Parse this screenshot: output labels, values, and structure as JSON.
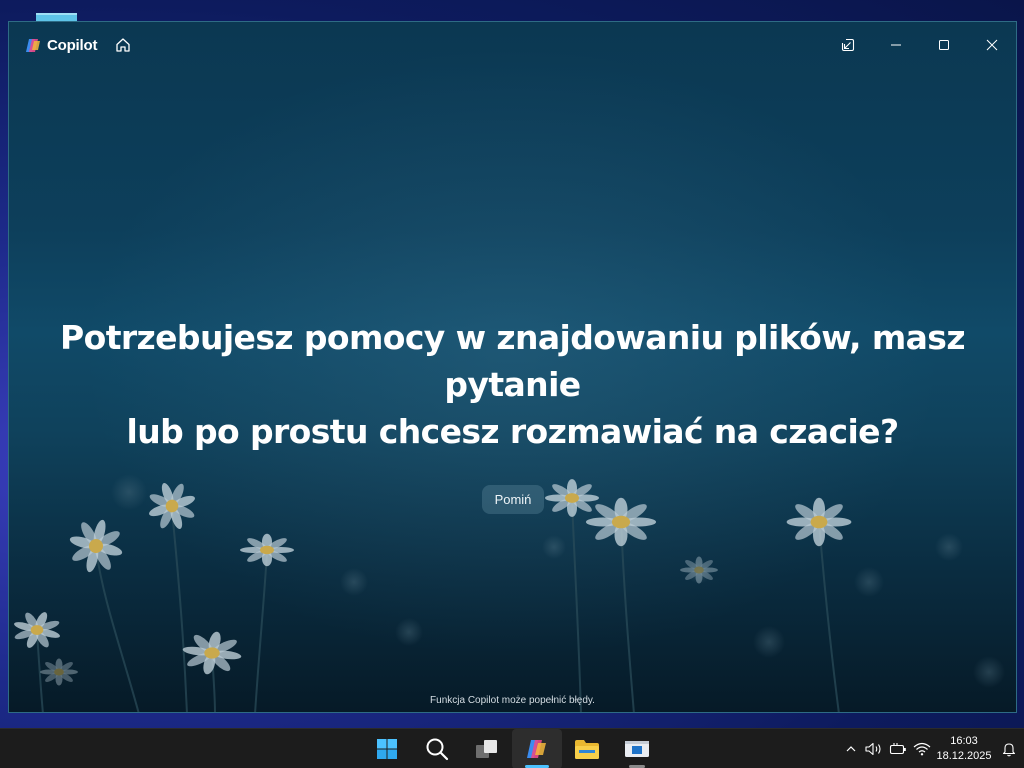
{
  "app": {
    "name": "Copilot"
  },
  "window": {
    "headline_line1": "Potrzebujesz pomocy w znajdowaniu plików, masz pytanie",
    "headline_line2": "lub po prostu chcesz rozmawiać na czacie?",
    "skip_label": "Pomiń",
    "disclaimer": "Funkcja Copilot może popełnić błędy."
  },
  "taskbar": {
    "time": "16:03",
    "date": "18.12.2025",
    "apps": [
      "windows-start-icon",
      "search-icon",
      "task-view-icon",
      "copilot-icon",
      "file-explorer-icon",
      "media-player-icon"
    ]
  },
  "colors": {
    "accent": "#4cc2ff",
    "taskbar_bg": "#1c1c1c"
  }
}
